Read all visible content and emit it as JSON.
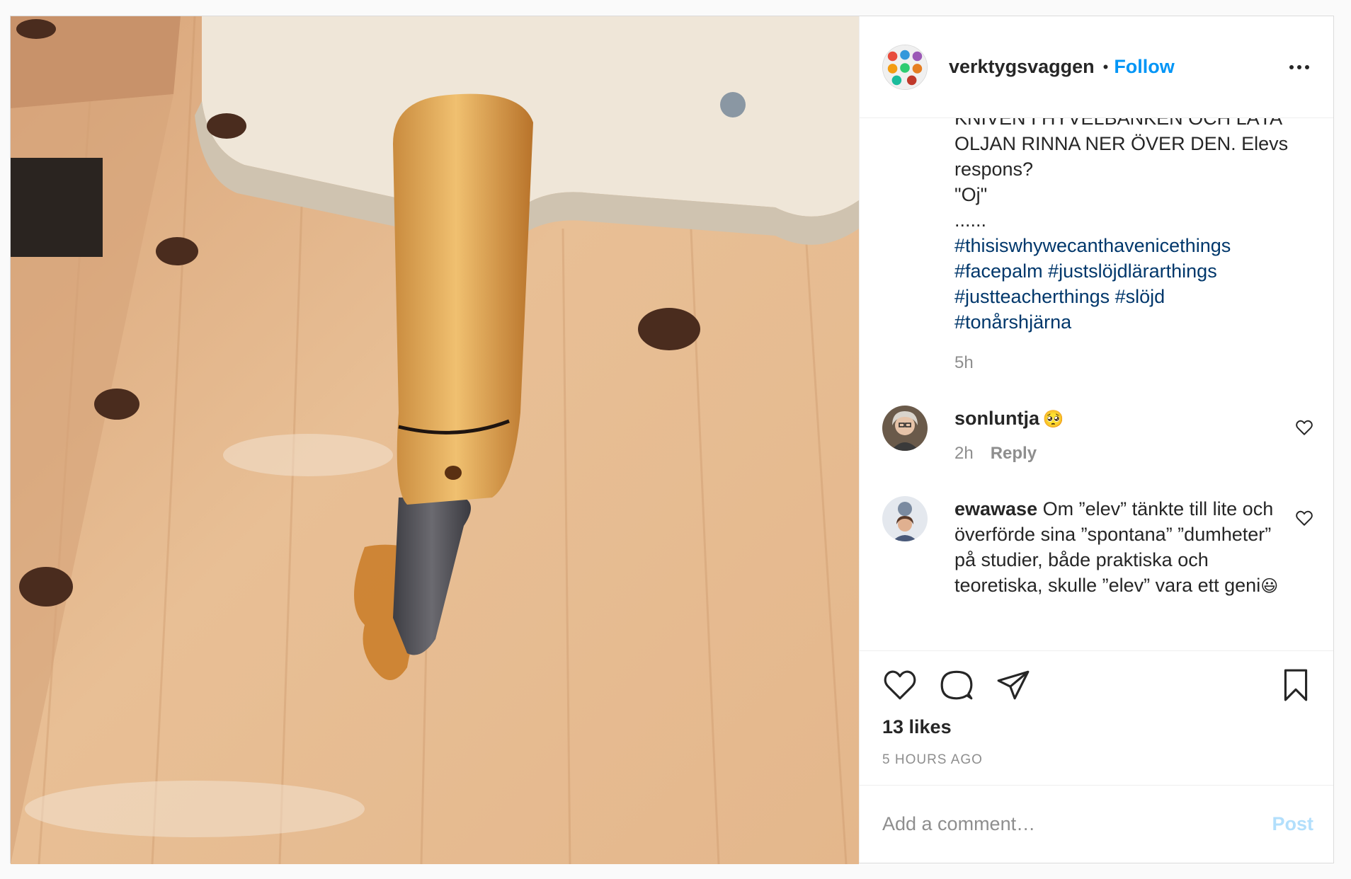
{
  "post": {
    "username": "verktygsvaggen",
    "separator": "•",
    "follow_label": "Follow",
    "more_icon": "more-horizontal-icon"
  },
  "caption": {
    "text_lines": [
      "KNIVEN I HYVELBANKEN OCH LÅTA",
      "OLJAN RINNA NER ÖVER DEN. Elevs",
      "respons?",
      "\"Oj\"",
      "......"
    ],
    "hashtags": [
      "#thisiswhywecanthavenicethings",
      "#facepalm #justslöjdlärarthings",
      "#justteacherthings #slöjd",
      "#tonårshjärna"
    ],
    "time": "5h"
  },
  "comments": [
    {
      "username": "sonluntja",
      "text": "",
      "emoji": "🥺",
      "time": "2h",
      "reply_label": "Reply"
    },
    {
      "username": "ewawase",
      "text": "Om ”elev” tänkte till lite och överförde sina ”spontana” ”dumheter” på studier, både praktiska och teoretiska, skulle ”elev” vara ett geni",
      "emoji": "😃"
    }
  ],
  "actions": {
    "likes": "13 likes",
    "posted_ago": "5 HOURS AGO"
  },
  "add_comment": {
    "placeholder": "Add a comment…",
    "post_label": "Post"
  },
  "colors": {
    "follow": "#0095f6",
    "hashtag": "#00376b",
    "muted": "#8e8e8e",
    "post_disabled": "#b2dffc"
  }
}
